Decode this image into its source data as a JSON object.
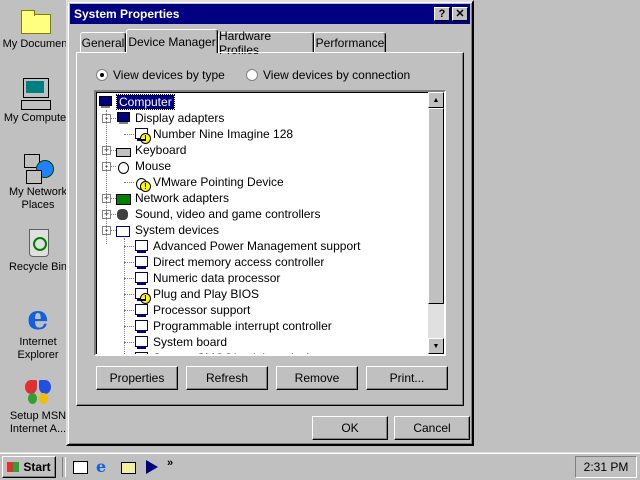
{
  "desktop": {
    "icons": [
      {
        "label": "My Documen"
      },
      {
        "label": "My Compute"
      },
      {
        "label": "My Network Places"
      },
      {
        "label": "Recycle Bin"
      },
      {
        "label": "Internet Explorer"
      },
      {
        "label": "Setup MSN Internet A..."
      }
    ]
  },
  "window": {
    "title": "System Properties",
    "help_label": "?",
    "close_label": "✕",
    "tabs": [
      "General",
      "Device Manager",
      "Hardware Profiles",
      "Performance"
    ],
    "active_tab": "Device Manager",
    "radio_by_type": "View devices by type",
    "radio_by_connection": "View devices by connection",
    "tree": [
      {
        "label": "Computer",
        "level": 0,
        "icon": "computer-icon",
        "selected": true
      },
      {
        "label": "Display adapters",
        "level": 1,
        "icon": "display-adapter-icon",
        "toggle": "−"
      },
      {
        "label": "Number Nine Imagine 128",
        "level": 2,
        "icon": "display-device-icon",
        "warning": true
      },
      {
        "label": "Keyboard",
        "level": 1,
        "icon": "keyboard-icon",
        "toggle": "+"
      },
      {
        "label": "Mouse",
        "level": 1,
        "icon": "mouse-icon",
        "toggle": "−"
      },
      {
        "label": "VMware Pointing Device",
        "level": 2,
        "icon": "mouse-device-icon",
        "warning": true
      },
      {
        "label": "Network adapters",
        "level": 1,
        "icon": "network-adapter-icon",
        "toggle": "+"
      },
      {
        "label": "Sound, video and game controllers",
        "level": 1,
        "icon": "sound-icon",
        "toggle": "+"
      },
      {
        "label": "System devices",
        "level": 1,
        "icon": "system-devices-icon",
        "toggle": "−"
      },
      {
        "label": "Advanced Power Management support",
        "level": 2,
        "icon": "system-device-icon"
      },
      {
        "label": "Direct memory access controller",
        "level": 2,
        "icon": "system-device-icon"
      },
      {
        "label": "Numeric data processor",
        "level": 2,
        "icon": "system-device-icon"
      },
      {
        "label": "Plug and Play BIOS",
        "level": 2,
        "icon": "system-device-icon",
        "warning": true
      },
      {
        "label": "Processor support",
        "level": 2,
        "icon": "system-device-icon"
      },
      {
        "label": "Programmable interrupt controller",
        "level": 2,
        "icon": "system-device-icon"
      },
      {
        "label": "System board",
        "level": 2,
        "icon": "system-device-icon"
      },
      {
        "label": "System CMOS/real time clock",
        "level": 2,
        "icon": "system-device-icon"
      }
    ],
    "buttons": {
      "properties": "Properties",
      "refresh": "Refresh",
      "remove": "Remove",
      "print": "Print...",
      "ok": "OK",
      "cancel": "Cancel"
    }
  },
  "taskbar": {
    "start_label": "Start",
    "chevron": "»",
    "clock": "2:31 PM"
  },
  "colors": {
    "titlebar": "#000080",
    "desktop": "#c0c0c0",
    "selection": "#000080"
  }
}
